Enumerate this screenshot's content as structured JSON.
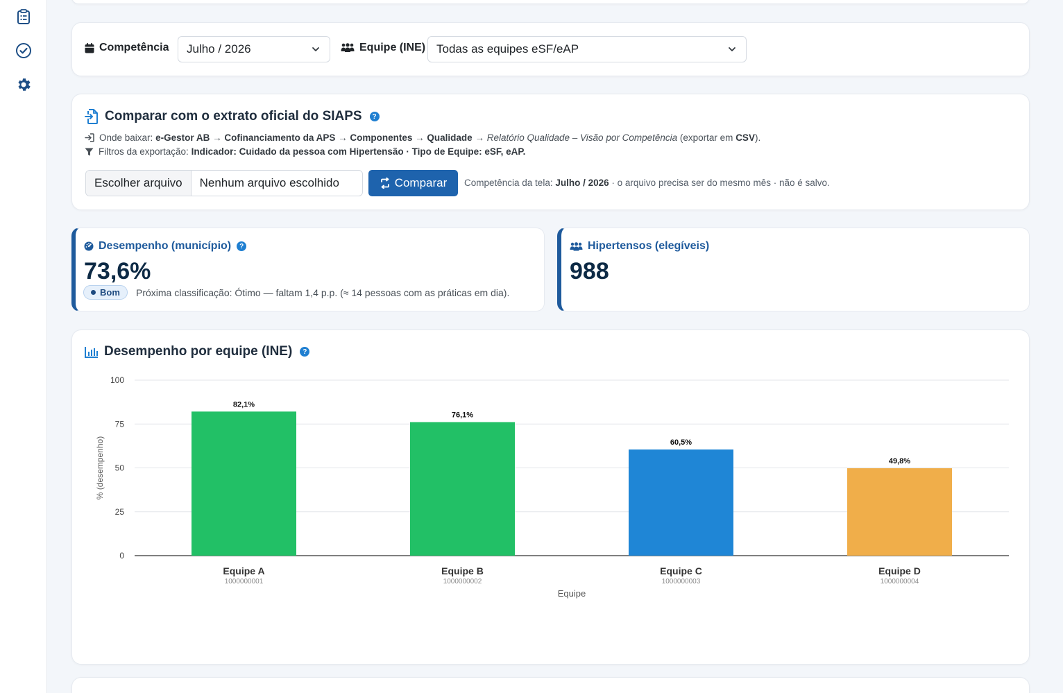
{
  "sidebar": {
    "items": [
      {
        "icon": "clipboard-list-icon"
      },
      {
        "icon": "check-circle-icon"
      },
      {
        "icon": "gear-icon"
      }
    ]
  },
  "filters": {
    "competencia_label": "Competência",
    "competencia_value": "Julho / 2026",
    "equipe_label": "Equipe (INE)",
    "equipe_value": "Todas as equipes eSF/eAP"
  },
  "compare": {
    "title": "Comparar com o extrato oficial do SIAPS",
    "download_prefix": "Onde baixar:",
    "path": [
      "e-Gestor AB",
      "Cofinanciamento da APS",
      "Componentes",
      "Qualidade"
    ],
    "report": "Relatório Qualidade – Visão por Competência",
    "export_prefix": "(exportar em",
    "export_format": "CSV",
    "export_suffix": ").",
    "filters_prefix": "Filtros da exportação:",
    "filters_value": "Indicador: Cuidado da pessoa com Hipertensão · Tipo de Equipe: eSF, eAP.",
    "choose_file_label": "Escolher arquivo",
    "no_file_label": "Nenhum arquivo escolhido",
    "compare_button": "Comparar",
    "note_prefix": "Competência da tela:",
    "note_competencia": "Julho / 2026",
    "note_suffix": "· o arquivo precisa ser do mesmo mês · não é salvo."
  },
  "kpis": {
    "desempenho": {
      "title": "Desempenho (município)",
      "value": "73,6%",
      "badge": "Bom",
      "subtitle": "Próxima classificação: Ótimo — faltam 1,4 p.p. (≈ 14 pessoas com as práticas em dia)."
    },
    "hipertensos": {
      "title": "Hipertensos (elegíveis)",
      "value": "988"
    }
  },
  "chart_section": {
    "title": "Desempenho por equipe (INE)"
  },
  "colors": {
    "primary": "#1e63ad",
    "kpi_accent": "#1e5a9c",
    "bar_green": "#22c066",
    "bar_blue": "#1f86d6",
    "bar_orange": "#f0ae4a"
  },
  "chart_data": {
    "type": "bar",
    "categories": [
      "Equipe A",
      "Equipe B",
      "Equipe C",
      "Equipe D"
    ],
    "category_codes": [
      "1000000001",
      "1000000002",
      "1000000003",
      "1000000004"
    ],
    "values": [
      82.1,
      76.1,
      60.5,
      49.8
    ],
    "value_labels": [
      "82,1%",
      "76,1%",
      "60,5%",
      "49,8%"
    ],
    "bar_colors": [
      "#22c066",
      "#22c066",
      "#1f86d6",
      "#f0ae4a"
    ],
    "xlabel": "Equipe",
    "ylabel": "% (desempenho)",
    "ylim": [
      0,
      100
    ],
    "yticks": [
      0,
      25,
      50,
      75,
      100
    ],
    "grid": true
  }
}
